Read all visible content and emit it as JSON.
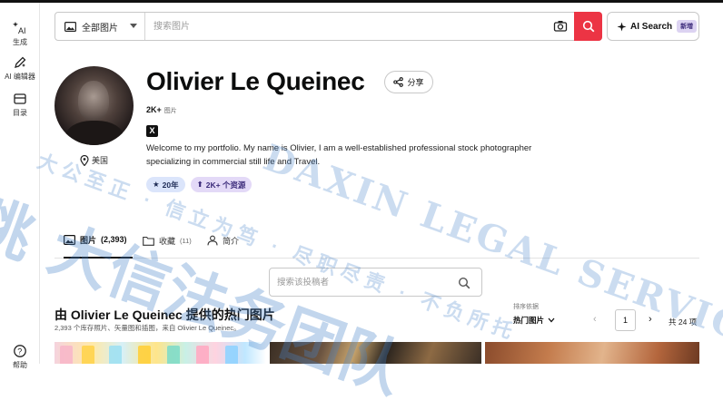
{
  "rail": {
    "items": [
      {
        "label": "生成",
        "badge": "AI"
      },
      {
        "label": "AI 编辑器"
      },
      {
        "label": "目录"
      },
      {
        "label": "帮助"
      }
    ]
  },
  "search": {
    "category": "全部图片",
    "placeholder": "搜索图片",
    "ai_label": "AI Search",
    "ai_badge": "新增"
  },
  "profile": {
    "name": "Olivier Le Queinec",
    "share_label": "分享",
    "count": "2K+",
    "count_unit": "图片",
    "x_logo": "X",
    "location": "美国",
    "bio": "Welcome to my portfolio. My name is Olivier, I am a well-established professional stock photographer specializing in commercial still life and Travel.",
    "badges": {
      "rating": "20年",
      "assets": "2K+ 个资源"
    }
  },
  "tabs": [
    {
      "label": "图片",
      "count": "(2,393)",
      "active": true
    },
    {
      "label": "收藏",
      "count": "(11)",
      "active": false
    },
    {
      "label": "简介",
      "count": "",
      "active": false
    }
  ],
  "contributor_search": {
    "placeholder": "搜索该投稿者"
  },
  "section": {
    "title": "由 Olivier Le Queinec 提供的热门图片",
    "subtitle": "2,393 个库存照片、矢量图和插图，来自 Olivier Le Queinec。"
  },
  "sort": {
    "label": "排序依据",
    "value": "热门图片"
  },
  "pager": {
    "current": "1",
    "total": "共 24 项"
  },
  "watermark": {
    "line1": "眺 大信法务团队",
    "line2": "大公至正 · 信立为笃 · 尽职尽责 · 不负所托",
    "line3": "DAXIN LEGAL SERVICE"
  },
  "colors": {
    "accent": "#ec3444",
    "ai_badge_bg": "#dcd3f2",
    "rating_bg": "#dbe5fb",
    "assets_bg": "#e3d9f7"
  }
}
